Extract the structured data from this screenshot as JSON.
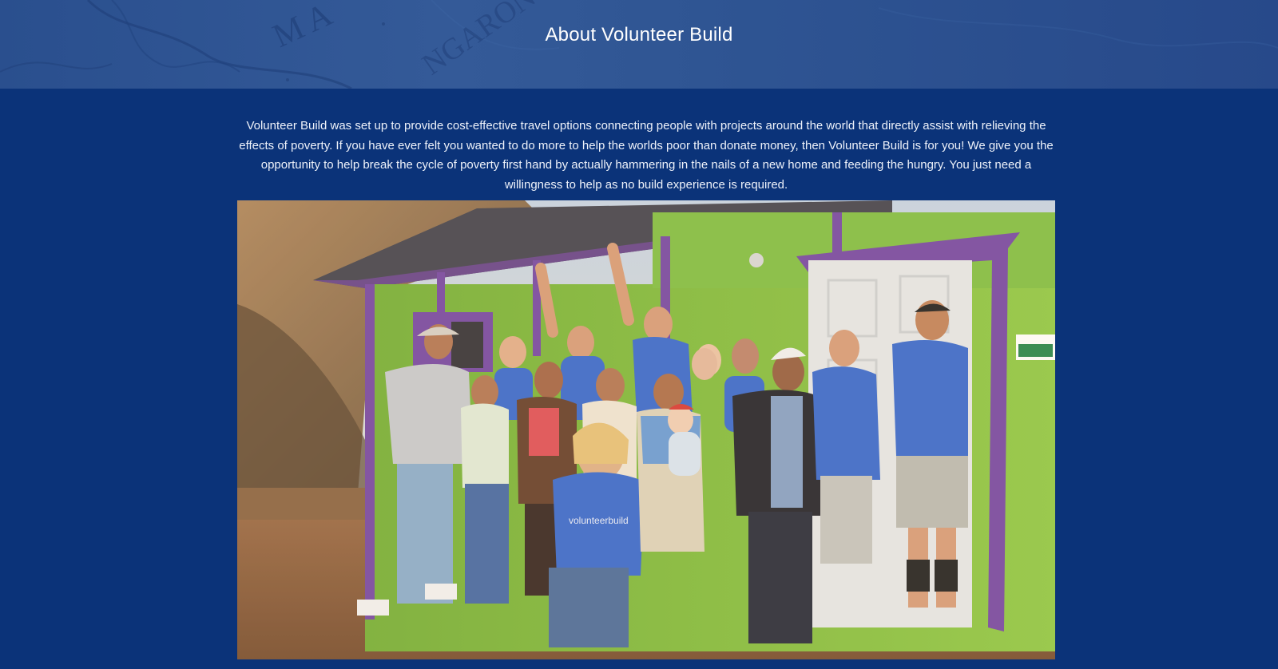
{
  "header": {
    "title": "About Volunteer Build",
    "background_map_lettering": "MA NGARONO"
  },
  "intro": {
    "paragraph": "Volunteer Build was set up to provide cost-effective travel options connecting people with projects around the world that directly assist with relieving the effects of poverty. If you have ever felt you wanted to do more to help the worlds poor than donate money, then Volunteer Build is for you! We give you the opportunity to help break the cycle of poverty first hand by actually hammering in the nails of a new home and feeding the hungry. You just need a willingness to help as no build experience is required."
  },
  "photo": {
    "shirt_lettering": "volunteerbuild"
  },
  "colors": {
    "page_background": "#0b3379",
    "header_background": "#2f5593",
    "text": "#ffffff",
    "house_wall": "#8bc34a",
    "house_trim": "#7b4fa8",
    "shirt_blue": "#3f6fd1"
  }
}
